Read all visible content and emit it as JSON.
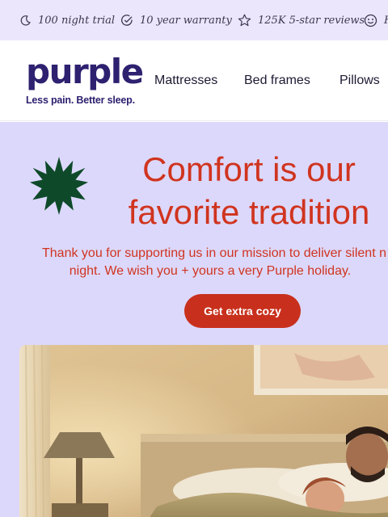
{
  "perks": [
    {
      "icon": "moon-icon",
      "label": "100 night trial"
    },
    {
      "icon": "check-circle-icon",
      "label": "10 year warranty"
    },
    {
      "icon": "star-outline-icon",
      "label": "125K 5-star reviews"
    },
    {
      "icon": "smile-badge-icon",
      "label": "F"
    }
  ],
  "header": {
    "logo_text": "purple",
    "tagline": "Less pain. Better sleep.",
    "nav": [
      "Mattresses",
      "Bed frames",
      "Pillows"
    ]
  },
  "hero": {
    "title_line1": "Comfort is our",
    "title_line2": "favorite tradition",
    "body_line1": "Thank you for supporting us in our mission to deliver silent n",
    "body_line2": "night. We wish you + yours a very Purple holiday.",
    "cta_label": "Get extra cozy",
    "photo_label": "couple sleeping in bed photo"
  },
  "colors": {
    "perks_bg": "#ebe6fb",
    "brand_purple": "#2d2170",
    "hero_bg": "#dcd8fb",
    "hero_text_red": "#d0341f",
    "cta_red": "#c8301d",
    "starburst_green": "#0e4a2a"
  }
}
